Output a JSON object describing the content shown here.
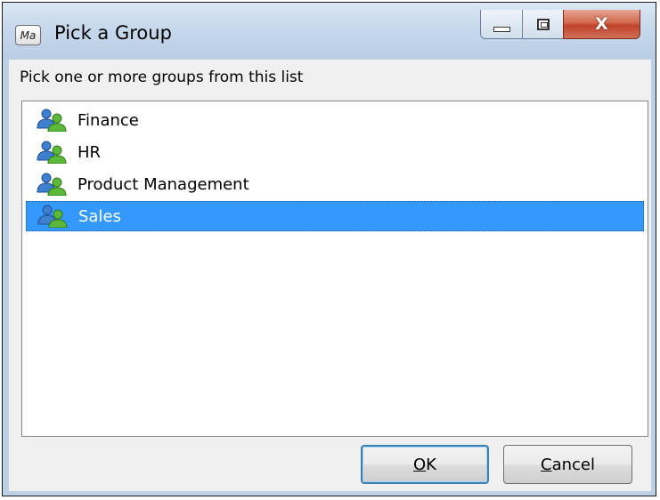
{
  "window": {
    "title": "Pick a Group",
    "app_icon_text": "Ma",
    "caption_buttons": {
      "minimize_icon": "minimize-icon",
      "maximize_icon": "maximize-icon",
      "close_icon": "close-icon",
      "close_glyph": "X"
    }
  },
  "dialog": {
    "prompt": "Pick one or more groups from this list",
    "groups": [
      {
        "label": "Finance",
        "icon": "group-users-icon",
        "selected": false
      },
      {
        "label": "HR",
        "icon": "group-users-icon",
        "selected": false
      },
      {
        "label": "Product Management",
        "icon": "group-users-icon",
        "selected": false
      },
      {
        "label": "Sales",
        "icon": "group-users-icon",
        "selected": true
      }
    ],
    "ok_button": {
      "accel": "O",
      "rest": "K"
    },
    "cancel_button": {
      "accel": "C",
      "rest": "ancel"
    }
  },
  "colors": {
    "selection": "#3399ff",
    "user_blue": "#3f7fcf",
    "user_green": "#5cb83a"
  }
}
